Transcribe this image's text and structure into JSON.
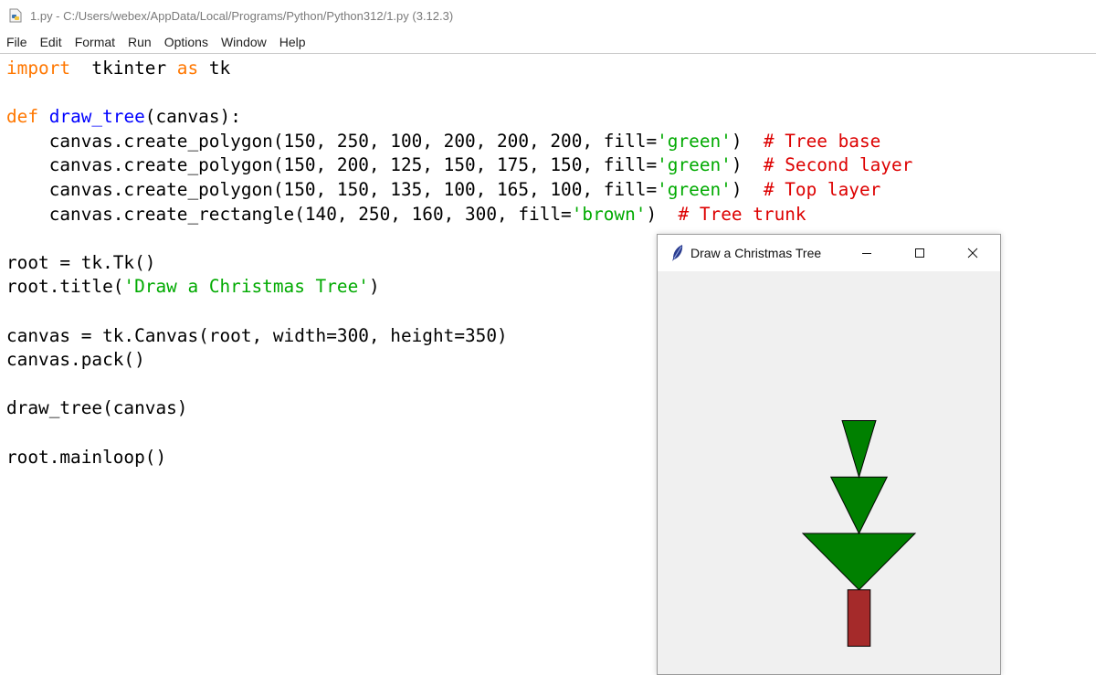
{
  "editor": {
    "title": "1.py - C:/Users/webex/AppData/Local/Programs/Python/Python312/1.py (3.12.3)",
    "menu": [
      "File",
      "Edit",
      "Format",
      "Run",
      "Options",
      "Window",
      "Help"
    ],
    "code": [
      [
        [
          "kw",
          "import"
        ],
        [
          "",
          "  tkinter "
        ],
        [
          "kw",
          "as"
        ],
        [
          "",
          " tk"
        ]
      ],
      [],
      [
        [
          "kw",
          "def"
        ],
        [
          "",
          " "
        ],
        [
          "def",
          "draw_tree"
        ],
        [
          "",
          "(canvas):"
        ]
      ],
      [
        [
          "",
          "    canvas.create_polygon(150, 250, 100, 200, 200, 200, fill="
        ],
        [
          "str",
          "'green'"
        ],
        [
          "",
          ")  "
        ],
        [
          "cmt",
          "# Tree base"
        ]
      ],
      [
        [
          "",
          "    canvas.create_polygon(150, 200, 125, 150, 175, 150, fill="
        ],
        [
          "str",
          "'green'"
        ],
        [
          "",
          ")  "
        ],
        [
          "cmt",
          "# Second layer"
        ]
      ],
      [
        [
          "",
          "    canvas.create_polygon(150, 150, 135, 100, 165, 100, fill="
        ],
        [
          "str",
          "'green'"
        ],
        [
          "",
          ")  "
        ],
        [
          "cmt",
          "# Top layer"
        ]
      ],
      [
        [
          "",
          "    canvas.create_rectangle(140, 250, 160, 300, fill="
        ],
        [
          "str",
          "'brown'"
        ],
        [
          "",
          ")  "
        ],
        [
          "cmt",
          "# Tree trunk"
        ]
      ],
      [],
      [
        [
          "",
          "root = tk.Tk()"
        ]
      ],
      [
        [
          "",
          "root.title("
        ],
        [
          "str",
          "'Draw a Christmas Tree'"
        ],
        [
          "",
          ")"
        ]
      ],
      [],
      [
        [
          "",
          "canvas = tk.Canvas(root, width=300, height=350)"
        ]
      ],
      [
        [
          "",
          "canvas.pack()"
        ]
      ],
      [],
      [
        [
          "",
          "draw_tree(canvas)"
        ]
      ],
      [],
      [
        [
          "",
          "root.mainloop()"
        ]
      ]
    ]
  },
  "tk_window": {
    "title": "Draw a Christmas Tree",
    "controls": [
      "minimize",
      "maximize",
      "close"
    ],
    "tree_fill": "#008000",
    "trunk_fill": "#a52a2a"
  }
}
